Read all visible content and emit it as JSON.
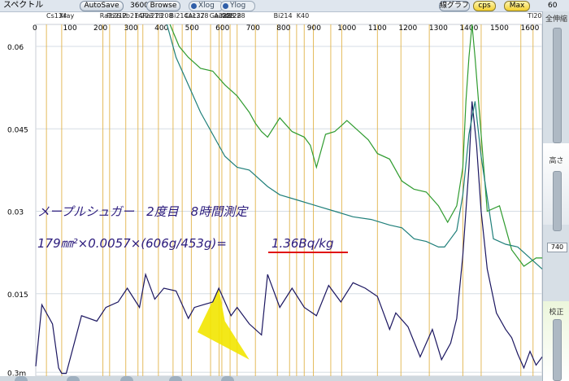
{
  "toolbar": {
    "title": "スペクトル",
    "autosave": "AutoSave",
    "counter": "3600",
    "browse": "Browse",
    "xlog": "Xlog",
    "ylog": "Ylog",
    "line_graph": "線グラフ",
    "cps": "cps",
    "max": "Max",
    "right_value": "60"
  },
  "side": {
    "full_scale": "全伸縮",
    "height": "高さ",
    "height_value": "740",
    "calibration": "校正"
  },
  "peak_labels": [
    "Cs134",
    "Xray",
    "Ra226",
    "Pb212",
    "Pb214",
    "Fr223",
    "Ra223",
    "Tl208",
    "Bi214",
    "Cs137",
    "Ac228",
    "Ga228",
    "Ac228",
    "Ac228",
    "Ac228",
    "Bi214",
    "K40",
    "Tl208"
  ],
  "annotation": {
    "line1": "メープルシュガー　2度目　8時間測定",
    "line2_prefix": "179㎜²×0.0057×(606g/453g)=",
    "line2_result": "1.36Bq/kg"
  },
  "colors": {
    "black_series": "#1b1660",
    "green_series": "#2f9b2f",
    "teal_series": "#1f7f7a",
    "gridline": "#e0b040",
    "annotation_text": "#2a1a7c",
    "underline": "#e01010",
    "roi_fill": "#f2e600"
  },
  "chart_data": {
    "type": "line",
    "x_ticks": [
      "0",
      "100",
      "200",
      "300",
      "400",
      "500",
      "600",
      "700",
      "800",
      "900",
      "1000",
      "1100",
      "1200",
      "1300",
      "1400",
      "1500",
      "1600"
    ],
    "y_ticks": [
      "0.3m",
      "0.015",
      "0.03",
      "0.045",
      "0.06"
    ],
    "xlim": [
      0,
      1660
    ],
    "ylim": [
      0,
      0.064
    ],
    "peak_lines": [
      35,
      85,
      220,
      242,
      295,
      335,
      351,
      402,
      450,
      480,
      510,
      573,
      601,
      610,
      637,
      660,
      720,
      792,
      832,
      855,
      880,
      910,
      967,
      1003,
      1120,
      1197,
      1290,
      1400,
      1460,
      1590,
      1630
    ],
    "series": [
      {
        "name": "",
        "color": "black",
        "x": [
          0,
          20,
          55,
          75,
          85,
          100,
          150,
          200,
          230,
          270,
          300,
          340,
          360,
          390,
          420,
          460,
          500,
          520,
          580,
          600,
          640,
          660,
          700,
          740,
          760,
          800,
          840,
          880,
          920,
          960,
          1000,
          1040,
          1080,
          1120,
          1160,
          1180,
          1220,
          1260,
          1300,
          1330,
          1360,
          1380,
          1400,
          1420,
          1430,
          1445,
          1460,
          1480,
          1510,
          1540,
          1560,
          1580,
          1600,
          1620,
          1640,
          1660
        ],
        "y": [
          0.0018,
          0.013,
          0.0095,
          0.0015,
          0.0005,
          0.0005,
          0.011,
          0.01,
          0.0125,
          0.0135,
          0.016,
          0.0125,
          0.0185,
          0.014,
          0.016,
          0.0155,
          0.0105,
          0.0125,
          0.0135,
          0.016,
          0.011,
          0.0125,
          0.0095,
          0.0075,
          0.0185,
          0.0125,
          0.016,
          0.0125,
          0.011,
          0.0165,
          0.0135,
          0.017,
          0.016,
          0.0145,
          0.0085,
          0.0115,
          0.009,
          0.0035,
          0.0085,
          0.003,
          0.006,
          0.0105,
          0.022,
          0.038,
          0.05,
          0.042,
          0.03,
          0.0195,
          0.0115,
          0.0085,
          0.007,
          0.004,
          0.0015,
          0.0045,
          0.002,
          0.0035
        ]
      },
      {
        "name": "",
        "color": "green",
        "x": [
          440,
          470,
          500,
          540,
          580,
          620,
          660,
          700,
          720,
          740,
          760,
          800,
          840,
          880,
          900,
          920,
          950,
          980,
          1000,
          1020,
          1060,
          1090,
          1120,
          1160,
          1200,
          1240,
          1280,
          1320,
          1350,
          1380,
          1400,
          1410,
          1420,
          1430,
          1440,
          1460,
          1480,
          1520,
          1560,
          1600,
          1640,
          1660
        ],
        "y": [
          0.0645,
          0.06,
          0.058,
          0.056,
          0.0555,
          0.053,
          0.051,
          0.048,
          0.046,
          0.0445,
          0.0435,
          0.047,
          0.0445,
          0.0435,
          0.042,
          0.038,
          0.044,
          0.0445,
          0.0455,
          0.0465,
          0.0445,
          0.043,
          0.0405,
          0.0395,
          0.0355,
          0.034,
          0.0335,
          0.031,
          0.028,
          0.031,
          0.038,
          0.05,
          0.058,
          0.064,
          0.058,
          0.044,
          0.03,
          0.031,
          0.023,
          0.02,
          0.0215,
          0.0215
        ]
      },
      {
        "name": "",
        "color": "teal",
        "x": [
          430,
          460,
          500,
          540,
          580,
          620,
          660,
          700,
          760,
          800,
          860,
          920,
          980,
          1040,
          1100,
          1160,
          1200,
          1240,
          1280,
          1320,
          1340,
          1360,
          1380,
          1400,
          1420,
          1440,
          1460,
          1500,
          1540,
          1580,
          1620,
          1660
        ],
        "y": [
          0.0645,
          0.058,
          0.053,
          0.048,
          0.044,
          0.04,
          0.038,
          0.0375,
          0.0345,
          0.033,
          0.032,
          0.031,
          0.03,
          0.029,
          0.0285,
          0.0275,
          0.027,
          0.025,
          0.0245,
          0.0235,
          0.0235,
          0.025,
          0.0265,
          0.033,
          0.044,
          0.05,
          0.04,
          0.025,
          0.024,
          0.0235,
          0.0215,
          0.0195
        ]
      }
    ]
  }
}
